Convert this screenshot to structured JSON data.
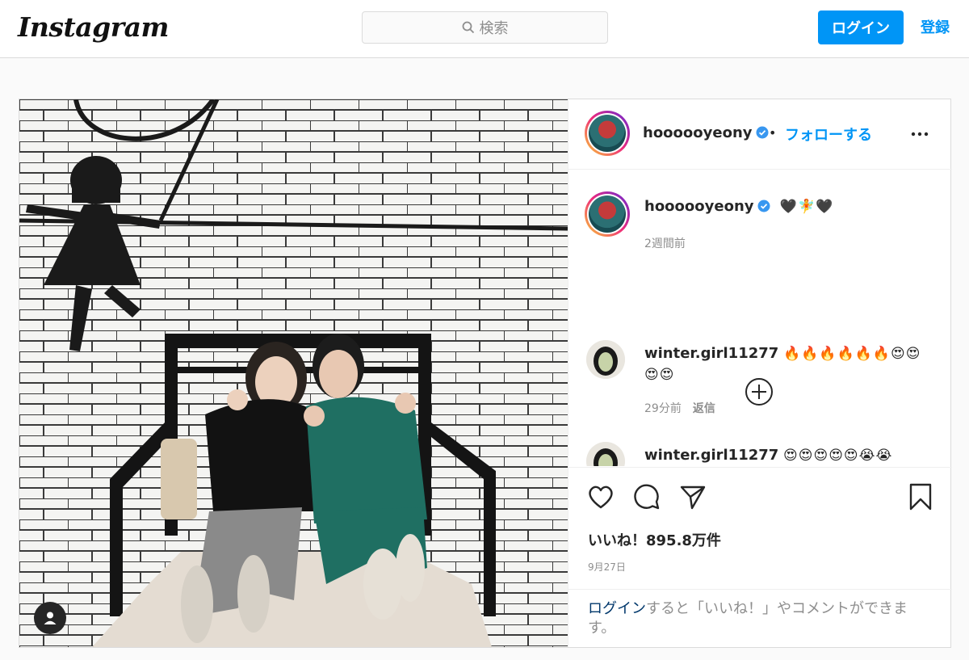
{
  "header": {
    "logo": "Instagram",
    "search_placeholder": "検索",
    "login_label": "ログイン",
    "signup_label": "登録"
  },
  "post": {
    "author": "hoooooyeony",
    "separator": "•",
    "follow_label": "フォローする",
    "caption": "🖤🧚🖤",
    "caption_time": "2週間前",
    "comments": [
      {
        "user": "winter.girl11277",
        "text": "🔥🔥🔥🔥🔥🔥😍😍😍😍",
        "time": "29分前",
        "reply_label": "返信"
      },
      {
        "user": "winter.girl11277",
        "text": "😍😍😍😍😍😭😭"
      }
    ],
    "likes": "いいね！895.8万件",
    "date": "9月27日",
    "login_prompt_link": "ログイン",
    "login_prompt_text": "すると「いいね！」やコメントができます。"
  },
  "colors": {
    "accent": "#0095f6",
    "border": "#dbdbdb",
    "muted": "#8e8e8e"
  },
  "icons": [
    "search-icon",
    "verified-icon",
    "more-icon",
    "load-more-icon",
    "heart-icon",
    "comment-icon",
    "share-icon",
    "bookmark-icon",
    "user-tag-icon"
  ]
}
